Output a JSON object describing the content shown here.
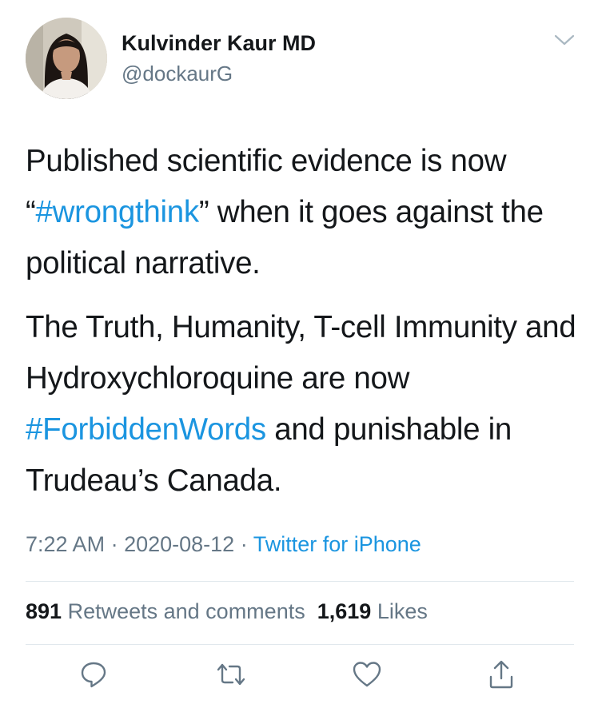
{
  "tweet": {
    "author": {
      "display_name": "Kulvinder Kaur MD",
      "handle": "@dockaurG",
      "avatar": "profile-photo"
    },
    "menu_icon": "chevron-down-icon",
    "text": {
      "p1_before": "Published scientific evidence is now “",
      "p1_hashtag": "#wrongthink",
      "p1_after": "” when it goes against the political narrative.",
      "p2_before": "The Truth, Humanity, T-cell Immunity and Hydroxychloroquine are now ",
      "p2_hashtag": "#ForbiddenWords",
      "p2_after": " and punishable in Trudeau’s Canada."
    },
    "meta": {
      "time": "7:22 AM",
      "separator": " · ",
      "date": "2020-08-12",
      "source": "Twitter for iPhone"
    },
    "stats": {
      "retweets_count": "891",
      "retweets_label": "Retweets and comments",
      "likes_count": "1,619",
      "likes_label": "Likes"
    },
    "actions": [
      {
        "name": "reply",
        "icon": "reply-icon"
      },
      {
        "name": "retweet",
        "icon": "retweet-icon"
      },
      {
        "name": "like",
        "icon": "heart-icon"
      },
      {
        "name": "share",
        "icon": "share-icon"
      }
    ],
    "colors": {
      "link": "#1b95e0",
      "text": "#14171a",
      "secondary": "#657786",
      "divider": "#e1e8ed"
    }
  }
}
